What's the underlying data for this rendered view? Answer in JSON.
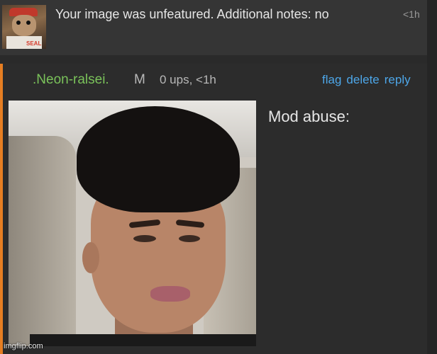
{
  "notification": {
    "text": "Your image was unfeatured. Additional notes: no",
    "time": "<1h",
    "thumbnail_label": "SEAL"
  },
  "comment": {
    "username": ".Neon-ralsei.",
    "badge": "M",
    "meta": "0 ups, <1h",
    "actions": {
      "flag": "flag",
      "delete": "delete",
      "reply": "reply"
    },
    "text": "Mod abuse:",
    "colors": {
      "username": "#7ac25a",
      "link": "#4da6e8",
      "accent_bar": "#e67e22"
    }
  },
  "watermark": "imgflip.com"
}
